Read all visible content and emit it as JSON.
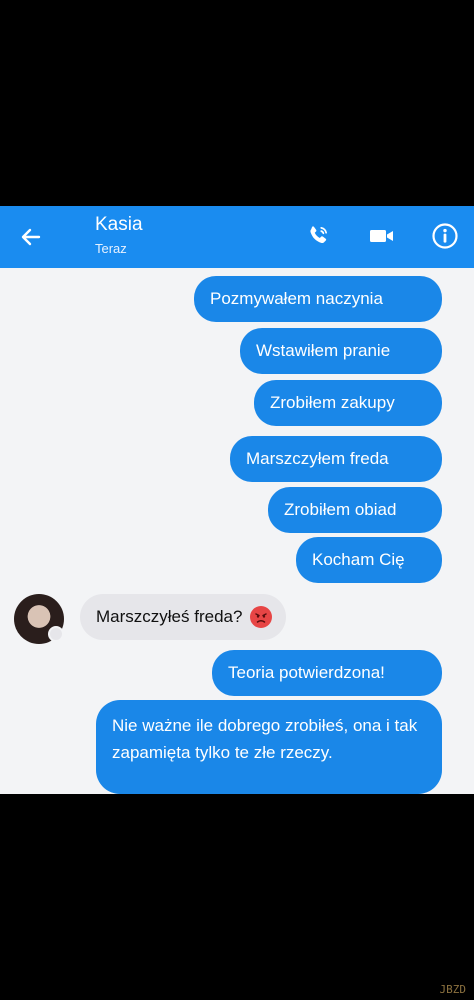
{
  "header": {
    "contact_name": "Kasia",
    "status": "Teraz",
    "back_icon": "back-arrow-icon",
    "call_icon": "phone-icon",
    "video_icon": "video-camera-icon",
    "info_icon": "info-icon",
    "color": "#1a8cf0"
  },
  "messages": [
    {
      "direction": "outgoing",
      "text": "Pozmywałem naczynia"
    },
    {
      "direction": "outgoing",
      "text": "Wstawiłem pranie"
    },
    {
      "direction": "outgoing",
      "text": "Zrobiłem zakupy"
    },
    {
      "direction": "outgoing",
      "text": "Marszczyłem freda"
    },
    {
      "direction": "outgoing",
      "text": "Zrobiłem obiad"
    },
    {
      "direction": "outgoing",
      "text": "Kocham Cię"
    },
    {
      "direction": "incoming",
      "text": "Marszczyłeś freda?",
      "emoji": "angry-face-icon"
    },
    {
      "direction": "outgoing",
      "text": "Teoria potwierdzona!"
    },
    {
      "direction": "outgoing",
      "text": "Nie ważne ile dobrego zrobiłeś, ona i tak zapamięta tylko te złe rzeczy."
    }
  ],
  "colors": {
    "outgoing_bubble": "#1a87e8",
    "incoming_bubble": "#e6e6ea"
  },
  "watermark": "JBZD"
}
